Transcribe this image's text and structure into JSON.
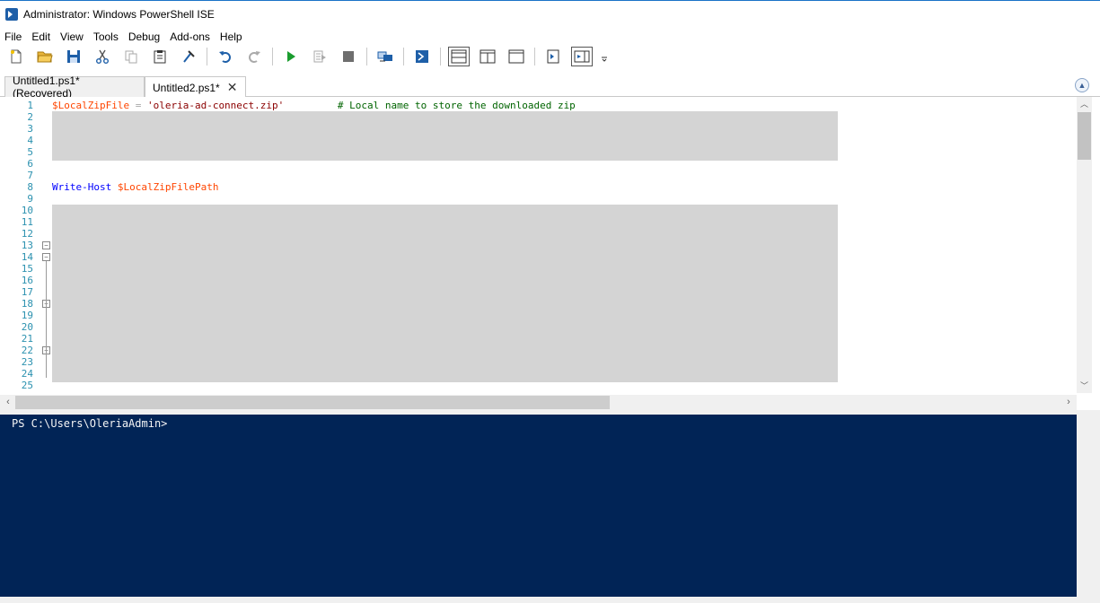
{
  "window": {
    "title": "Administrator: Windows PowerShell ISE",
    "app_icon": "powershell-icon"
  },
  "menu": {
    "items": [
      "File",
      "Edit",
      "View",
      "Tools",
      "Debug",
      "Add-ons",
      "Help"
    ]
  },
  "toolbar": {
    "icons": [
      "new-file-icon",
      "open-folder-icon",
      "save-icon",
      "cut-icon",
      "copy-icon",
      "paste-icon",
      "clear-console-icon",
      "undo-icon",
      "redo-icon",
      "run-script-icon",
      "run-selection-icon",
      "stop-icon",
      "remote-tab-icon",
      "start-powershell-icon",
      "layout-top-icon",
      "layout-right-icon",
      "layout-max-icon",
      "show-script-pane-icon",
      "show-commands-icon",
      "toolbar-overflow-icon"
    ]
  },
  "tabs": [
    {
      "label": "Untitled1.ps1*(Recovered)",
      "active": false
    },
    {
      "label": "Untitled2.ps1*",
      "active": true,
      "close_glyph": "✕"
    }
  ],
  "editor": {
    "line_numbers": [
      "1",
      "2",
      "3",
      "4",
      "5",
      "6",
      "7",
      "8",
      "9",
      "10",
      "11",
      "12",
      "13",
      "14",
      "15",
      "16",
      "17",
      "18",
      "19",
      "20",
      "21",
      "22",
      "23",
      "24",
      "25"
    ],
    "line1": {
      "var": "$LocalZipFile",
      "op": " = ",
      "str": "'oleria-ad-connect.zip'",
      "pad": "         ",
      "comment": "# Local name to store the downloaded zip"
    },
    "line8": {
      "cmdlet": "Write-Host",
      "space": " ",
      "var": "$LocalZipFilePath"
    },
    "fold_glyph": "−",
    "scroll_up": "︿",
    "scroll_down": "﹀",
    "scroll_left": "‹",
    "scroll_right": "›"
  },
  "console": {
    "prompt": "PS C:\\Users\\OleriaAdmin>"
  },
  "colors": {
    "console_bg": "#012456",
    "line_number": "#2b91af",
    "variable": "#ff4500",
    "string": "#8b0000",
    "comment": "#006400",
    "cmdlet": "#0000ff",
    "redaction": "#d4d4d4"
  }
}
